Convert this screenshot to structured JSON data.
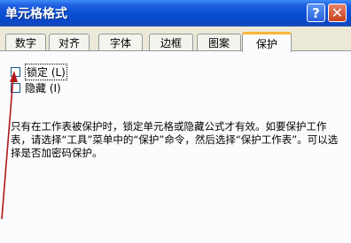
{
  "window": {
    "title": "单元格格式",
    "help_label": "?",
    "close_label": "✕"
  },
  "tabs": [
    {
      "label": "数字",
      "active": false
    },
    {
      "label": "对齐",
      "active": false
    },
    {
      "label": "字体",
      "active": false
    },
    {
      "label": "边框",
      "active": false
    },
    {
      "label": "图案",
      "active": false
    },
    {
      "label": "保护",
      "active": true
    }
  ],
  "protection": {
    "locked_label": "锁定 (L)",
    "locked_checked": false,
    "hidden_label": "隐藏 (I)",
    "hidden_checked": false,
    "description": "只有在工作表被保护时，锁定单元格或隐藏公式才有效。如要保护工作表，请选择“工具”菜单中的“保护”命令，然后选择“保护工作表”。可以选择是否加密码保护。"
  },
  "colors": {
    "titlebar": "#0a4ed4",
    "dialog_bg": "#ece9d8",
    "active_tab_accent": "#f7b53a",
    "arrow": "#b01818"
  }
}
